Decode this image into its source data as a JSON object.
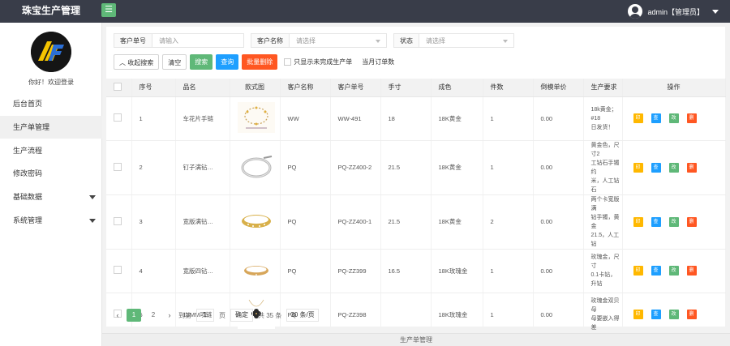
{
  "header": {
    "title": "珠宝生产管理",
    "menu_icon": "☰",
    "user_label": "admin【管理员】"
  },
  "sidebar": {
    "greeting": "你好！欢迎登录",
    "items": [
      {
        "label": "后台首页"
      },
      {
        "label": "生产单管理"
      },
      {
        "label": "生产流程"
      },
      {
        "label": "修改密码"
      },
      {
        "label": "基础数据"
      },
      {
        "label": "系统管理"
      }
    ]
  },
  "filters": {
    "order_no_label": "客户单号",
    "order_no_placeholder": "请输入",
    "customer_label": "客户名称",
    "customer_placeholder": "请选择",
    "status_label": "状态",
    "status_placeholder": "请选择"
  },
  "actions": {
    "collapse_search": "收起搜索",
    "clear": "清空",
    "search": "搜索",
    "query": "查询",
    "batch_delete": "批量删除",
    "only_unfinished": "只显示未完成生产单",
    "current_month_orders": "当月订单数"
  },
  "table": {
    "headers": [
      "序号",
      "品名",
      "款式图",
      "客户名称",
      "客户单号",
      "手寸",
      "成色",
      "件数",
      "倒模单价",
      "生产要求",
      "操作"
    ],
    "rows": [
      {
        "no": "1",
        "name": "车花片手链",
        "customer": "WW",
        "order_no": "WW-491",
        "size": "18",
        "metal": "18K黄金",
        "qty": "1",
        "price": "0.00",
        "req": "18k黄金；#18\n日发货！"
      },
      {
        "no": "2",
        "name": "钉子满钻…",
        "customer": "PQ",
        "order_no": "PQ-ZZ400-2",
        "size": "21.5",
        "metal": "18K黄金",
        "qty": "1",
        "price": "0.00",
        "req": "黄金色，尺寸2\n工钻石手镯约\n米，人工钻石"
      },
      {
        "no": "3",
        "name": "宽版满钻…",
        "customer": "PQ",
        "order_no": "PQ-ZZ400-1",
        "size": "21.5",
        "metal": "18K黄金",
        "qty": "2",
        "price": "0.00",
        "req": "两个卡宽版满\n钻手镯，黄金\n21.5，人工钻"
      },
      {
        "no": "4",
        "name": "宽版四钻…",
        "customer": "PQ",
        "order_no": "PQ-ZZ399",
        "size": "16.5",
        "metal": "18K玫瑰金",
        "qty": "1",
        "price": "0.00",
        "req": "玫瑰金，尺寸\n0.1卡钻，升钻"
      },
      {
        "no": "5",
        "name": "15MM项链",
        "customer": "PQ",
        "order_no": "PQ-ZZ398",
        "size": "",
        "metal": "18K玫瑰金",
        "qty": "1",
        "price": "0.00",
        "req": "玫瑰金双贝母\n母要嵌入得差"
      }
    ],
    "op_labels": [
      "印",
      "查",
      "改",
      "删"
    ]
  },
  "pager": {
    "prev": "‹",
    "next": "›",
    "pages": [
      "1",
      "2"
    ],
    "goto_prefix": "到第",
    "goto_value": "1",
    "goto_suffix": "页",
    "confirm": "确定",
    "total": "共 35 条",
    "per_page": "30 条/页"
  },
  "footer": {
    "text": "生产单管理"
  },
  "colors": {
    "topbar": "#393d49",
    "green": "#5fb878",
    "blue": "#1e9fff",
    "red": "#ff5722",
    "yellow": "#ffb800"
  }
}
